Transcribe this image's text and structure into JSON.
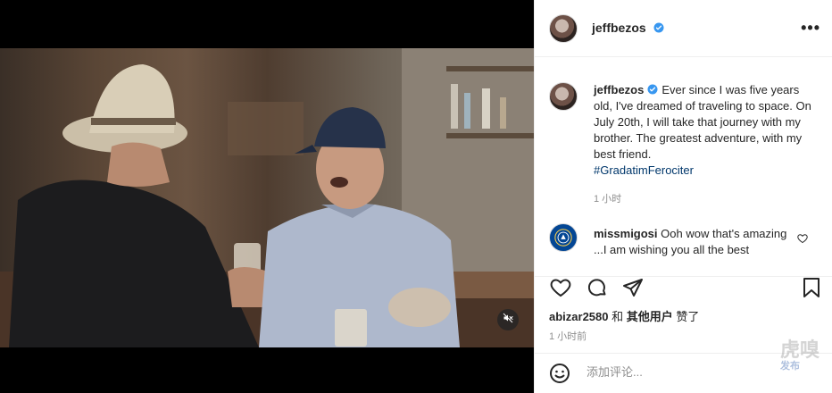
{
  "video": {
    "mute_icon": "speaker-muted-icon"
  },
  "post_header": {
    "username": "jeffbezos",
    "verified_icon": "verified-badge-icon",
    "more_icon": "more-options-icon",
    "more_glyph": "•••"
  },
  "caption": {
    "username": "jeffbezos",
    "text": "Ever since I was five years old, I've dreamed of traveling to space. On July 20th, I will take that journey with my brother. The greatest adventure, with my best friend.",
    "hashtag": "#GradatimFerociter",
    "time_ago": "1 小时"
  },
  "comments": [
    {
      "username": "missmigosi",
      "text": "Ooh wow that's amazing ...I am wishing you all the best"
    }
  ],
  "actions": {
    "like_icon": "heart-icon",
    "comment_icon": "comment-icon",
    "share_icon": "share-icon",
    "save_icon": "bookmark-icon"
  },
  "likes": {
    "first_user": "abizar2580",
    "connector": " 和 ",
    "others": "其他用户",
    "suffix": " 赞了"
  },
  "posted_ago": "1 小时前",
  "add_comment": {
    "emoji_icon": "emoji-icon",
    "placeholder": "添加评论..."
  },
  "watermark": {
    "main": "虎嗅",
    "sub": "发布"
  },
  "colors": {
    "link": "#00376b",
    "verified": "#3897f0",
    "secondary_text": "#8e8e8e",
    "border": "#efefef"
  }
}
